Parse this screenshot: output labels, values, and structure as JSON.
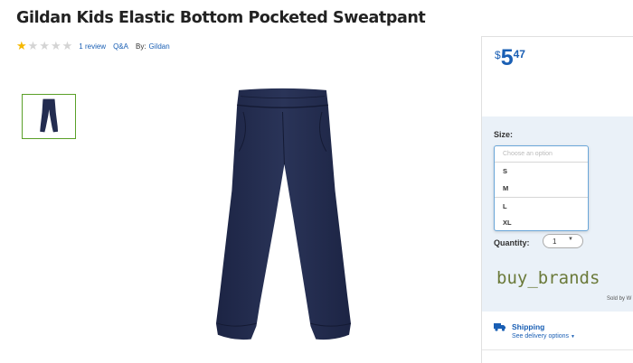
{
  "product": {
    "title": "Gildan Kids Elastic Bottom Pocketed Sweatpant",
    "rating": {
      "value": 1,
      "max": 5
    },
    "reviews_link": "1 review",
    "qa_link": "Q&A",
    "by_label": "By:",
    "brand": "Gildan",
    "thumbnail_icon": "sweatpant-thumbnail-icon",
    "main_image_icon": "sweatpant-image"
  },
  "price": {
    "currency": "$",
    "dollars": "5",
    "cents": "47"
  },
  "size": {
    "label": "Size:",
    "placeholder": "Choose an option",
    "options": [
      "S",
      "M",
      "L",
      "XL"
    ]
  },
  "quantity": {
    "label": "Quantity:",
    "value": "1"
  },
  "watermark": "buy_brands",
  "sold_by": "Sold by W",
  "shipping": {
    "title": "Shipping",
    "link": "See delivery options",
    "icon": "truck-icon"
  },
  "colors": {
    "accent": "#1a5fb4",
    "panel_bg": "#eaf1f8",
    "star": "#f5b800",
    "thumb_border": "#5aa028",
    "pants": "#232c50"
  }
}
